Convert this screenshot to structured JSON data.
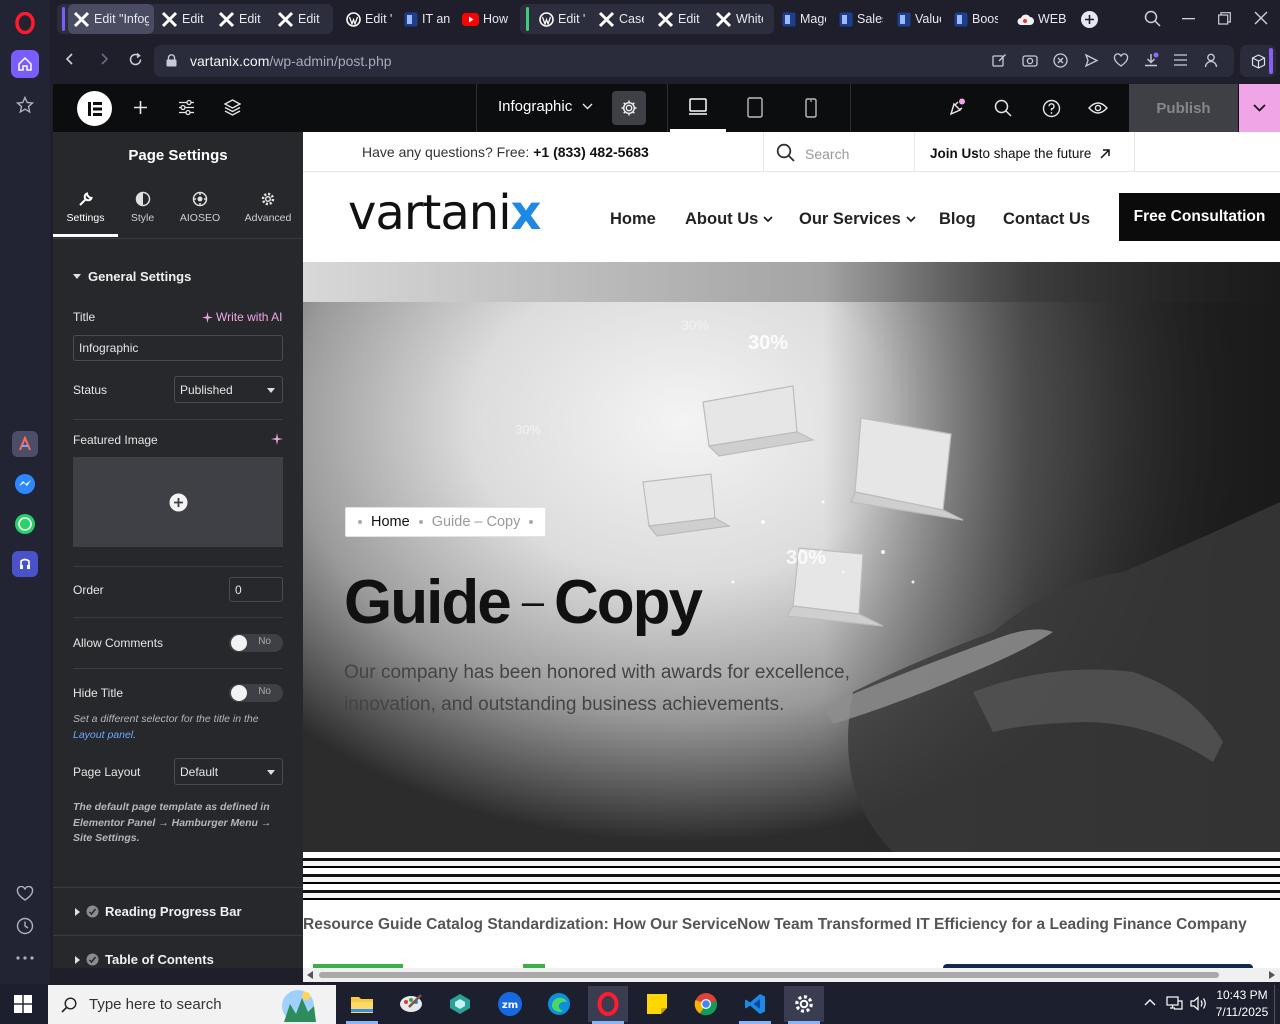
{
  "browser": {
    "tabs": [
      {
        "label": "Edit \"Infog",
        "icon": "elementor-x-icon",
        "active": true
      },
      {
        "label": "Edit P",
        "icon": "elementor-x-icon"
      },
      {
        "label": "Edit C",
        "icon": "elementor-x-icon"
      },
      {
        "label": "Edit C",
        "icon": "elementor-x-icon"
      },
      {
        "label": "Edit \"",
        "icon": "wordpress-icon"
      },
      {
        "label": "IT anc",
        "icon": "site-icon"
      },
      {
        "label": "How t",
        "icon": "youtube-icon"
      },
      {
        "label": "Edit \"",
        "icon": "wordpress-icon"
      },
      {
        "label": "Case",
        "icon": "elementor-x-icon"
      },
      {
        "label": "Edit \"",
        "icon": "elementor-x-icon"
      },
      {
        "label": "White",
        "icon": "elementor-x-icon"
      },
      {
        "label": "Mage",
        "icon": "site-icon"
      },
      {
        "label": "Sales",
        "icon": "site-icon"
      },
      {
        "label": "Value",
        "icon": "site-icon"
      },
      {
        "label": "Boost",
        "icon": "site-icon"
      },
      {
        "label": "WEBP",
        "icon": "cloud-icon"
      }
    ],
    "url_domain": "vartanix.com",
    "url_path": "/wp-admin/post.php",
    "colors": {
      "accent": "#8b5cf6",
      "opera_red": "#ff1b2d"
    }
  },
  "elementor": {
    "page_name": "Infographic",
    "publish_label": "Publish"
  },
  "panel": {
    "title": "Page Settings",
    "tabs": [
      {
        "label": "Settings",
        "icon": "wrench-icon",
        "active": true
      },
      {
        "label": "Style",
        "icon": "half-circle-icon"
      },
      {
        "label": "AIOSEO",
        "icon": "aioseo-icon"
      },
      {
        "label": "Advanced",
        "icon": "gear-icon"
      }
    ],
    "section_general": "General Settings",
    "title_label": "Title",
    "write_ai": "Write with AI",
    "title_value": "Infographic",
    "status_label": "Status",
    "status_value": "Published",
    "featured_image_label": "Featured Image",
    "order_label": "Order",
    "order_value": "0",
    "allow_comments_label": "Allow Comments",
    "allow_comments_value": "No",
    "hide_title_label": "Hide Title",
    "hide_title_value": "No",
    "hide_title_help": "Set a different selector for the title in the",
    "layout_panel_link": "Layout panel",
    "page_layout_label": "Page Layout",
    "page_layout_value": "Default",
    "page_layout_help": "The default page template as defined in Elementor Panel → Hamburger Menu → Site Settings.",
    "section_reading": "Reading Progress Bar",
    "section_toc": "Table of Contents"
  },
  "site": {
    "topbar_question": "Have any questions? Free:",
    "topbar_phone": "+1 (833) 482-5683",
    "search_placeholder": "Search",
    "join_bold": "Join Us",
    "join_rest": " to shape the future",
    "logo_text": "vartani",
    "logo_x": "x",
    "nav": [
      "Home",
      "About Us",
      "Our Services",
      "Blog",
      "Contact Us"
    ],
    "cta": "Free Consultation",
    "breadcrumb_home": "Home",
    "breadcrumb_current": "Guide – Copy",
    "hero_title_1": "Guide",
    "hero_title_dash": "–",
    "hero_title_2": "Copy",
    "hero_text": "Our company has been honored with awards for excellence, innovation, and outstanding business achievements.",
    "hero_pct": [
      "30%",
      "30%",
      "30%",
      "30%"
    ],
    "ticker": "Resource Guide Catalog Standardization: How Our ServiceNow Team Transformed IT Efficiency for a Leading Finance Company"
  },
  "taskbar": {
    "search_placeholder": "Type here to search",
    "time": "10:43 PM",
    "date": "7/11/2025"
  }
}
